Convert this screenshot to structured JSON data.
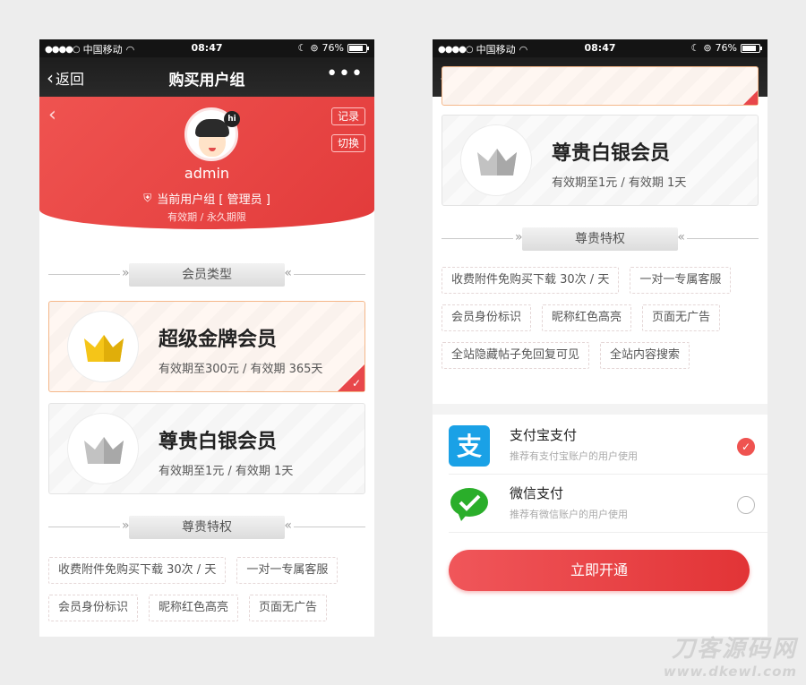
{
  "status_bar": {
    "carrier": "中国移动",
    "time": "08:47",
    "battery": "76%"
  },
  "nav": {
    "back_label": "返回",
    "title": "购买用户组",
    "more": "•••"
  },
  "profile": {
    "username": "admin",
    "avatar_badge": "hi",
    "current_group": "当前用户组 [ 管理员 ]",
    "validity": "有效期 / 永久期限",
    "record_label": "记录",
    "switch_label": "切换"
  },
  "sections": {
    "member_type": "会员类型",
    "privileges": "尊贵特权"
  },
  "memberships": [
    {
      "title": "超级金牌会员",
      "subtitle": "有效期至300元 / 有效期 365天",
      "crown": "gold-crown-icon",
      "selected": true
    },
    {
      "title": "尊贵白银会员",
      "subtitle": "有效期至1元 / 有效期 1天",
      "crown": "silver-crown-icon",
      "selected": false
    }
  ],
  "privileges": [
    "收费附件免购买下载 30次 / 天",
    "一对一专属客服",
    "会员身份标识",
    "昵称红色高亮",
    "页面无广告",
    "全站隐藏帖子免回复可见",
    "全站内容搜索"
  ],
  "payment": [
    {
      "name": "支付宝支付",
      "desc": "推荐有支付宝账户的用户使用",
      "icon": "alipay-icon",
      "selected": true
    },
    {
      "name": "微信支付",
      "desc": "推荐有微信账户的用户使用",
      "icon": "wechat-pay-icon",
      "selected": false
    }
  ],
  "submit_label": "立即开通",
  "watermark": {
    "line1": "刀客源码网",
    "line2": "www.dkewl.com"
  },
  "colors": {
    "accent": "#e8474b",
    "gold": "#f5c518",
    "silver": "#b5b5b5",
    "alipay": "#1aa1e6",
    "wechat": "#2aae2a"
  }
}
